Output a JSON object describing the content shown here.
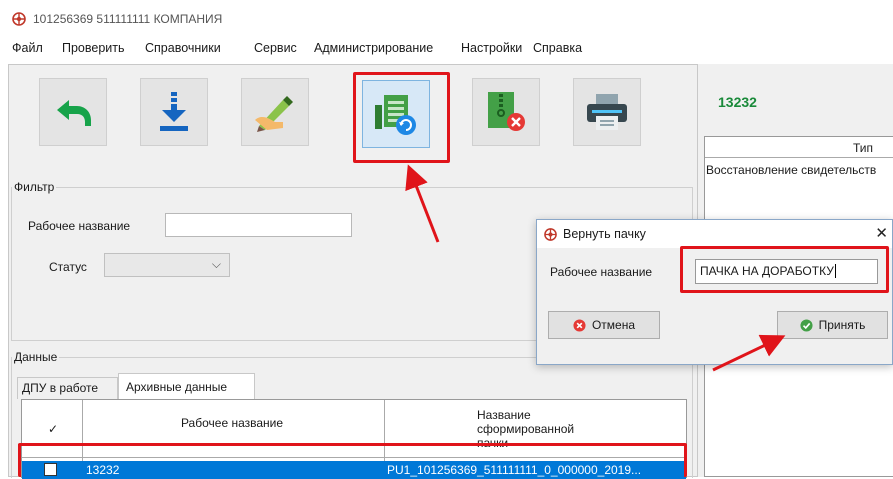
{
  "window": {
    "title": "101256369 511111111 КОМПАНИЯ"
  },
  "menu": [
    "Файл",
    "Проверить",
    "Справочники",
    "Сервис",
    "Администрирование",
    "Настройки",
    "Справка"
  ],
  "toolbar": {
    "buttons": [
      {
        "icon": "undo-arrow-icon"
      },
      {
        "icon": "download-icon"
      },
      {
        "icon": "edit-pen-icon"
      },
      {
        "icon": "return-batch-icon",
        "selected": true
      },
      {
        "icon": "archive-delete-icon"
      },
      {
        "icon": "printer-icon"
      }
    ]
  },
  "filter": {
    "legend": "Фильтр",
    "name_label": "Рабочее название",
    "name_value": "",
    "status_label": "Статус",
    "status_value": ""
  },
  "data_section": {
    "legend": "Данные",
    "tabs": [
      "ДПУ в работе",
      "Архивные данные"
    ],
    "active_tab": 1,
    "columns": [
      "✓",
      "Рабочее название",
      "Название сформированной пачки"
    ],
    "rows": [
      {
        "checked": false,
        "name": "13232",
        "batch": "PU1_101256369_511111111_0_000000_2019..."
      }
    ]
  },
  "right_panel": {
    "heading": "13232",
    "column": "Тип",
    "row": "Восстановление свидетельств"
  },
  "dialog": {
    "title": "Вернуть пачку",
    "label": "Рабочее название",
    "value": "ПАЧКА НА ДОРАБОТКУ",
    "cancel": "Отмена",
    "accept": "Принять",
    "close": "✕"
  },
  "colors": {
    "accent_red": "#e0141a",
    "selection": "#0078d7",
    "heading_green": "#1a8a3a",
    "button_selected": "#d7e8f7"
  }
}
